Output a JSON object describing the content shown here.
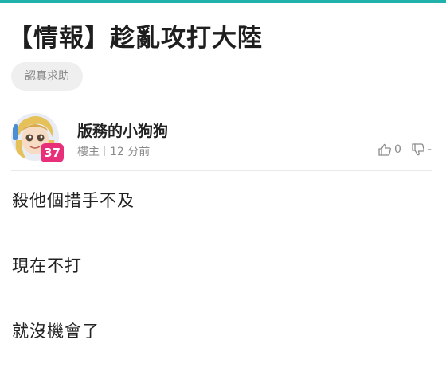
{
  "colors": {
    "accent_bar": "#20b2aa",
    "level_badge": "#e8307a"
  },
  "post": {
    "title": "【情報】趁亂攻打大陸",
    "tag": "認真求助"
  },
  "reply": {
    "avatar_icon": "cartoon-avatar",
    "level": "37",
    "author": "版務的小狗狗",
    "role": "樓主",
    "time": "12 分前",
    "upvote_icon": "thumbs-up-icon",
    "upvote_count": "0",
    "downvote_icon": "thumbs-down-icon",
    "downvote_count": "-",
    "lines": [
      "殺他個措手不及",
      "現在不打",
      "就沒機會了"
    ]
  }
}
